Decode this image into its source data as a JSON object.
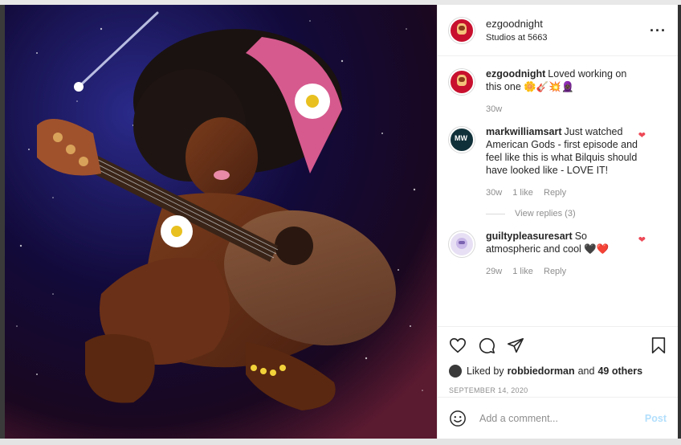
{
  "post": {
    "username": "ezgoodnight",
    "location": "Studios at 5663"
  },
  "image": {
    "icon": "illustration-woman-playing-guitar"
  },
  "comments": [
    {
      "username": "ezgoodnight",
      "text": "Loved working on this one 🌼🎸💥🧕🏿",
      "age": "30w",
      "likes": "",
      "reply": ""
    },
    {
      "username": "markwilliamsart",
      "avatar_text": "MW",
      "text": "Just watched American Gods - first episode and feel like this is what Bilquis should have looked like - LOVE IT!",
      "age": "30w",
      "likes": "1 like",
      "reply": "Reply"
    },
    {
      "username": "guiltypleasuresart",
      "text": "So atmospheric and cool 🖤❤️",
      "age": "29w",
      "likes": "1 like",
      "reply": "Reply"
    }
  ],
  "view_replies": "View replies (3)",
  "liked_by": {
    "prefix": "Liked by",
    "user": "robbiedorman",
    "and": "and",
    "count": "49 others"
  },
  "date": "SEPTEMBER 14, 2020",
  "composer": {
    "placeholder": "Add a comment...",
    "post_label": "Post"
  },
  "colors": {
    "heart": "#ed4956",
    "post_button": "#b2dffc",
    "muted_text": "#8e8e8e"
  },
  "icons": [
    "more-options-icon",
    "heart-icon",
    "comment-icon",
    "share-icon",
    "bookmark-icon",
    "emoji-icon"
  ]
}
